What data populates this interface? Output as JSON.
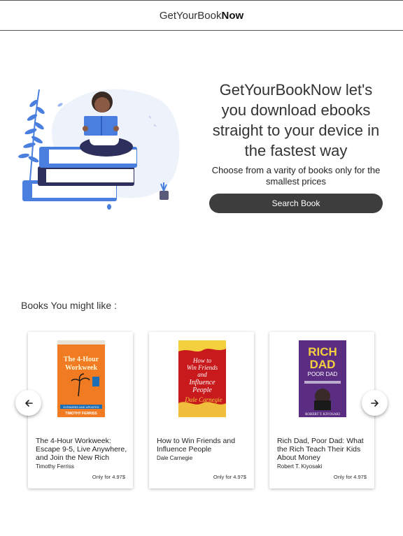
{
  "navbar": {
    "brand_light": "GetYourBook",
    "brand_bold": "Now"
  },
  "hero": {
    "title": "GetYourBookNow let's you download ebooks straight to your device in the fastest way",
    "subtitle": "Choose from a varity of books only for the smallest prices",
    "search_button": "Search Book"
  },
  "recommendations": {
    "heading": "Books You might like :",
    "books": [
      {
        "title": "The 4-Hour Workweek: Escape 9-5, Live Anywhere, and Join the New Rich",
        "author": "Timothy Ferriss",
        "price": "Only for 4.97$",
        "cover": {
          "title_lines": [
            "The 4-Hour",
            "Workweek"
          ],
          "tagline": "EXPANDED AND UPDATED",
          "author": "TIMOTHY FERRISS",
          "bg": "#f07b22",
          "accent": "#1c6fb5"
        }
      },
      {
        "title": "How to Win Friends and Influence People",
        "author": "Dale Carnegie",
        "price": "Only for 4.97$",
        "cover": {
          "title_lines": [
            "How to",
            "Win Friends",
            "and",
            "Influence",
            "People"
          ],
          "author": "Dale Carnegie",
          "bg": "#c8191c",
          "accent": "#f4d03f"
        }
      },
      {
        "title": "Rich Dad, Poor Dad: What the Rich Teach Their Kids About Money",
        "author": "Robert T. Kiyosaki",
        "price": "Only for 4.97$",
        "cover": {
          "title_lines": [
            "RICH",
            "DAD",
            "POOR DAD"
          ],
          "author": "ROBERT T. KIYOSAKI",
          "bg": "#5a2d82",
          "accent": "#f4d03f"
        }
      }
    ]
  },
  "colors": {
    "primary_dark": "#3d3d3d",
    "illustration_blue": "#4a7fe0",
    "illustration_navy": "#2d2f5c"
  }
}
